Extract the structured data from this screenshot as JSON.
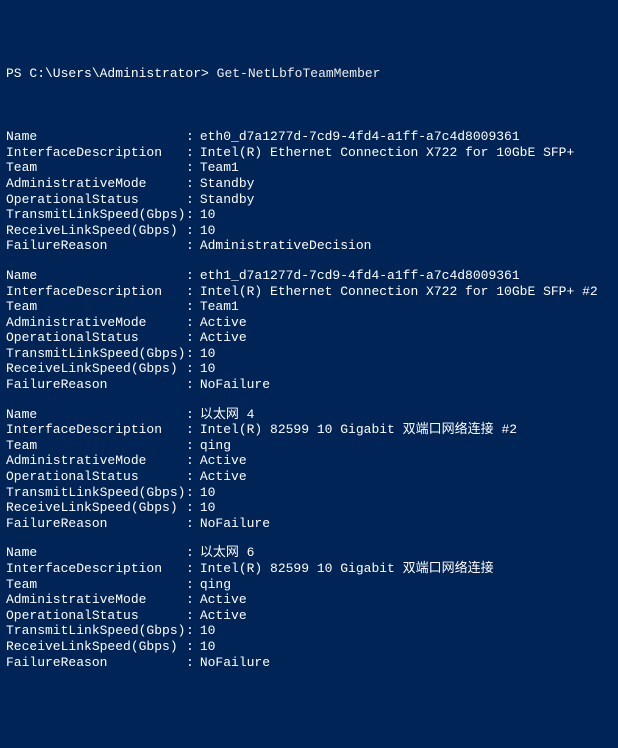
{
  "prompt": "PS C:\\Users\\Administrator>",
  "command": "Get-NetLbfoTeamMember",
  "labels": {
    "Name": "Name",
    "InterfaceDescription": "InterfaceDescription",
    "Team": "Team",
    "AdministrativeMode": "AdministrativeMode",
    "OperationalStatus": "OperationalStatus",
    "TransmitLinkSpeed": "TransmitLinkSpeed(Gbps)",
    "ReceiveLinkSpeed": "ReceiveLinkSpeed(Gbps)",
    "FailureReason": "FailureReason"
  },
  "members": [
    {
      "Name": "eth0_d7a1277d-7cd9-4fd4-a1ff-a7c4d8009361",
      "InterfaceDescription": "Intel(R) Ethernet Connection X722 for 10GbE SFP+",
      "Team": "Team1",
      "AdministrativeMode": "Standby",
      "OperationalStatus": "Standby",
      "TransmitLinkSpeed": "10",
      "ReceiveLinkSpeed": "10",
      "FailureReason": "AdministrativeDecision"
    },
    {
      "Name": "eth1_d7a1277d-7cd9-4fd4-a1ff-a7c4d8009361",
      "InterfaceDescription": "Intel(R) Ethernet Connection X722 for 10GbE SFP+ #2",
      "Team": "Team1",
      "AdministrativeMode": "Active",
      "OperationalStatus": "Active",
      "TransmitLinkSpeed": "10",
      "ReceiveLinkSpeed": "10",
      "FailureReason": "NoFailure"
    },
    {
      "Name": "以太网 4",
      "InterfaceDescription": "Intel(R) 82599 10 Gigabit 双端口网络连接 #2",
      "Team": "qing",
      "AdministrativeMode": "Active",
      "OperationalStatus": "Active",
      "TransmitLinkSpeed": "10",
      "ReceiveLinkSpeed": "10",
      "FailureReason": "NoFailure"
    },
    {
      "Name": "以太网 6",
      "InterfaceDescription": "Intel(R) 82599 10 Gigabit 双端口网络连接",
      "Team": "qing",
      "AdministrativeMode": "Active",
      "OperationalStatus": "Active",
      "TransmitLinkSpeed": "10",
      "ReceiveLinkSpeed": "10",
      "FailureReason": "NoFailure"
    }
  ]
}
